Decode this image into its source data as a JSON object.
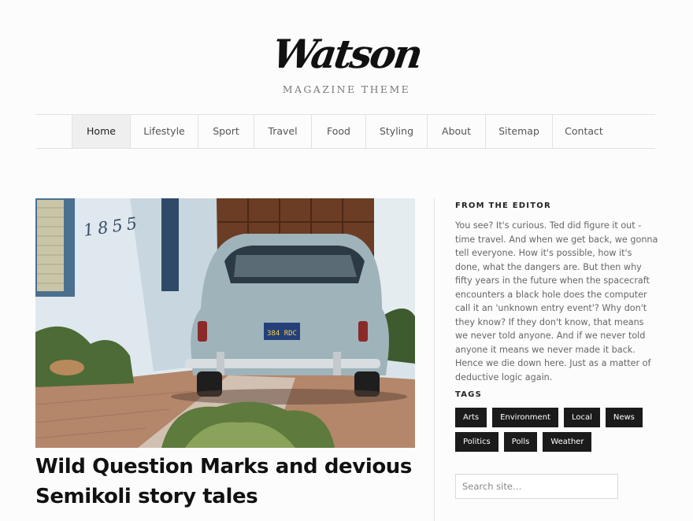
{
  "site": {
    "logo": "Watson",
    "tagline": "MAGAZINE THEME"
  },
  "nav": {
    "items": [
      {
        "label": "Home",
        "active": true
      },
      {
        "label": "Lifestyle"
      },
      {
        "label": "Sport"
      },
      {
        "label": "Travel"
      },
      {
        "label": "Food"
      },
      {
        "label": "Styling"
      },
      {
        "label": "About"
      },
      {
        "label": "Sitemap"
      },
      {
        "label": "Contact"
      }
    ]
  },
  "post": {
    "image_alt": "Classic car parked in front of a white house",
    "house_number": "1855",
    "plate": "384 RDC",
    "title": "Wild Question Marks and devious Semikoli story tales"
  },
  "sidebar": {
    "editor_title": "FROM THE EDITOR",
    "editor_text": "You see? It's curious. Ted did figure it out - time travel. And when we get back, we gonna tell everyone. How it's possible, how it's done, what the dangers are. But then why fifty years in the future when the spacecraft encounters a black hole does the computer call it an 'unknown entry event'? Why don't they know? If they don't know, that means we never told anyone. And if we never told anyone it means we never made it back. Hence we die down here. Just as a matter of deductive logic again.",
    "tags_title": "TAGS",
    "tags": [
      "Arts",
      "Environment",
      "Local",
      "News",
      "Politics",
      "Polls",
      "Weather"
    ],
    "search_placeholder": "Search site…"
  }
}
